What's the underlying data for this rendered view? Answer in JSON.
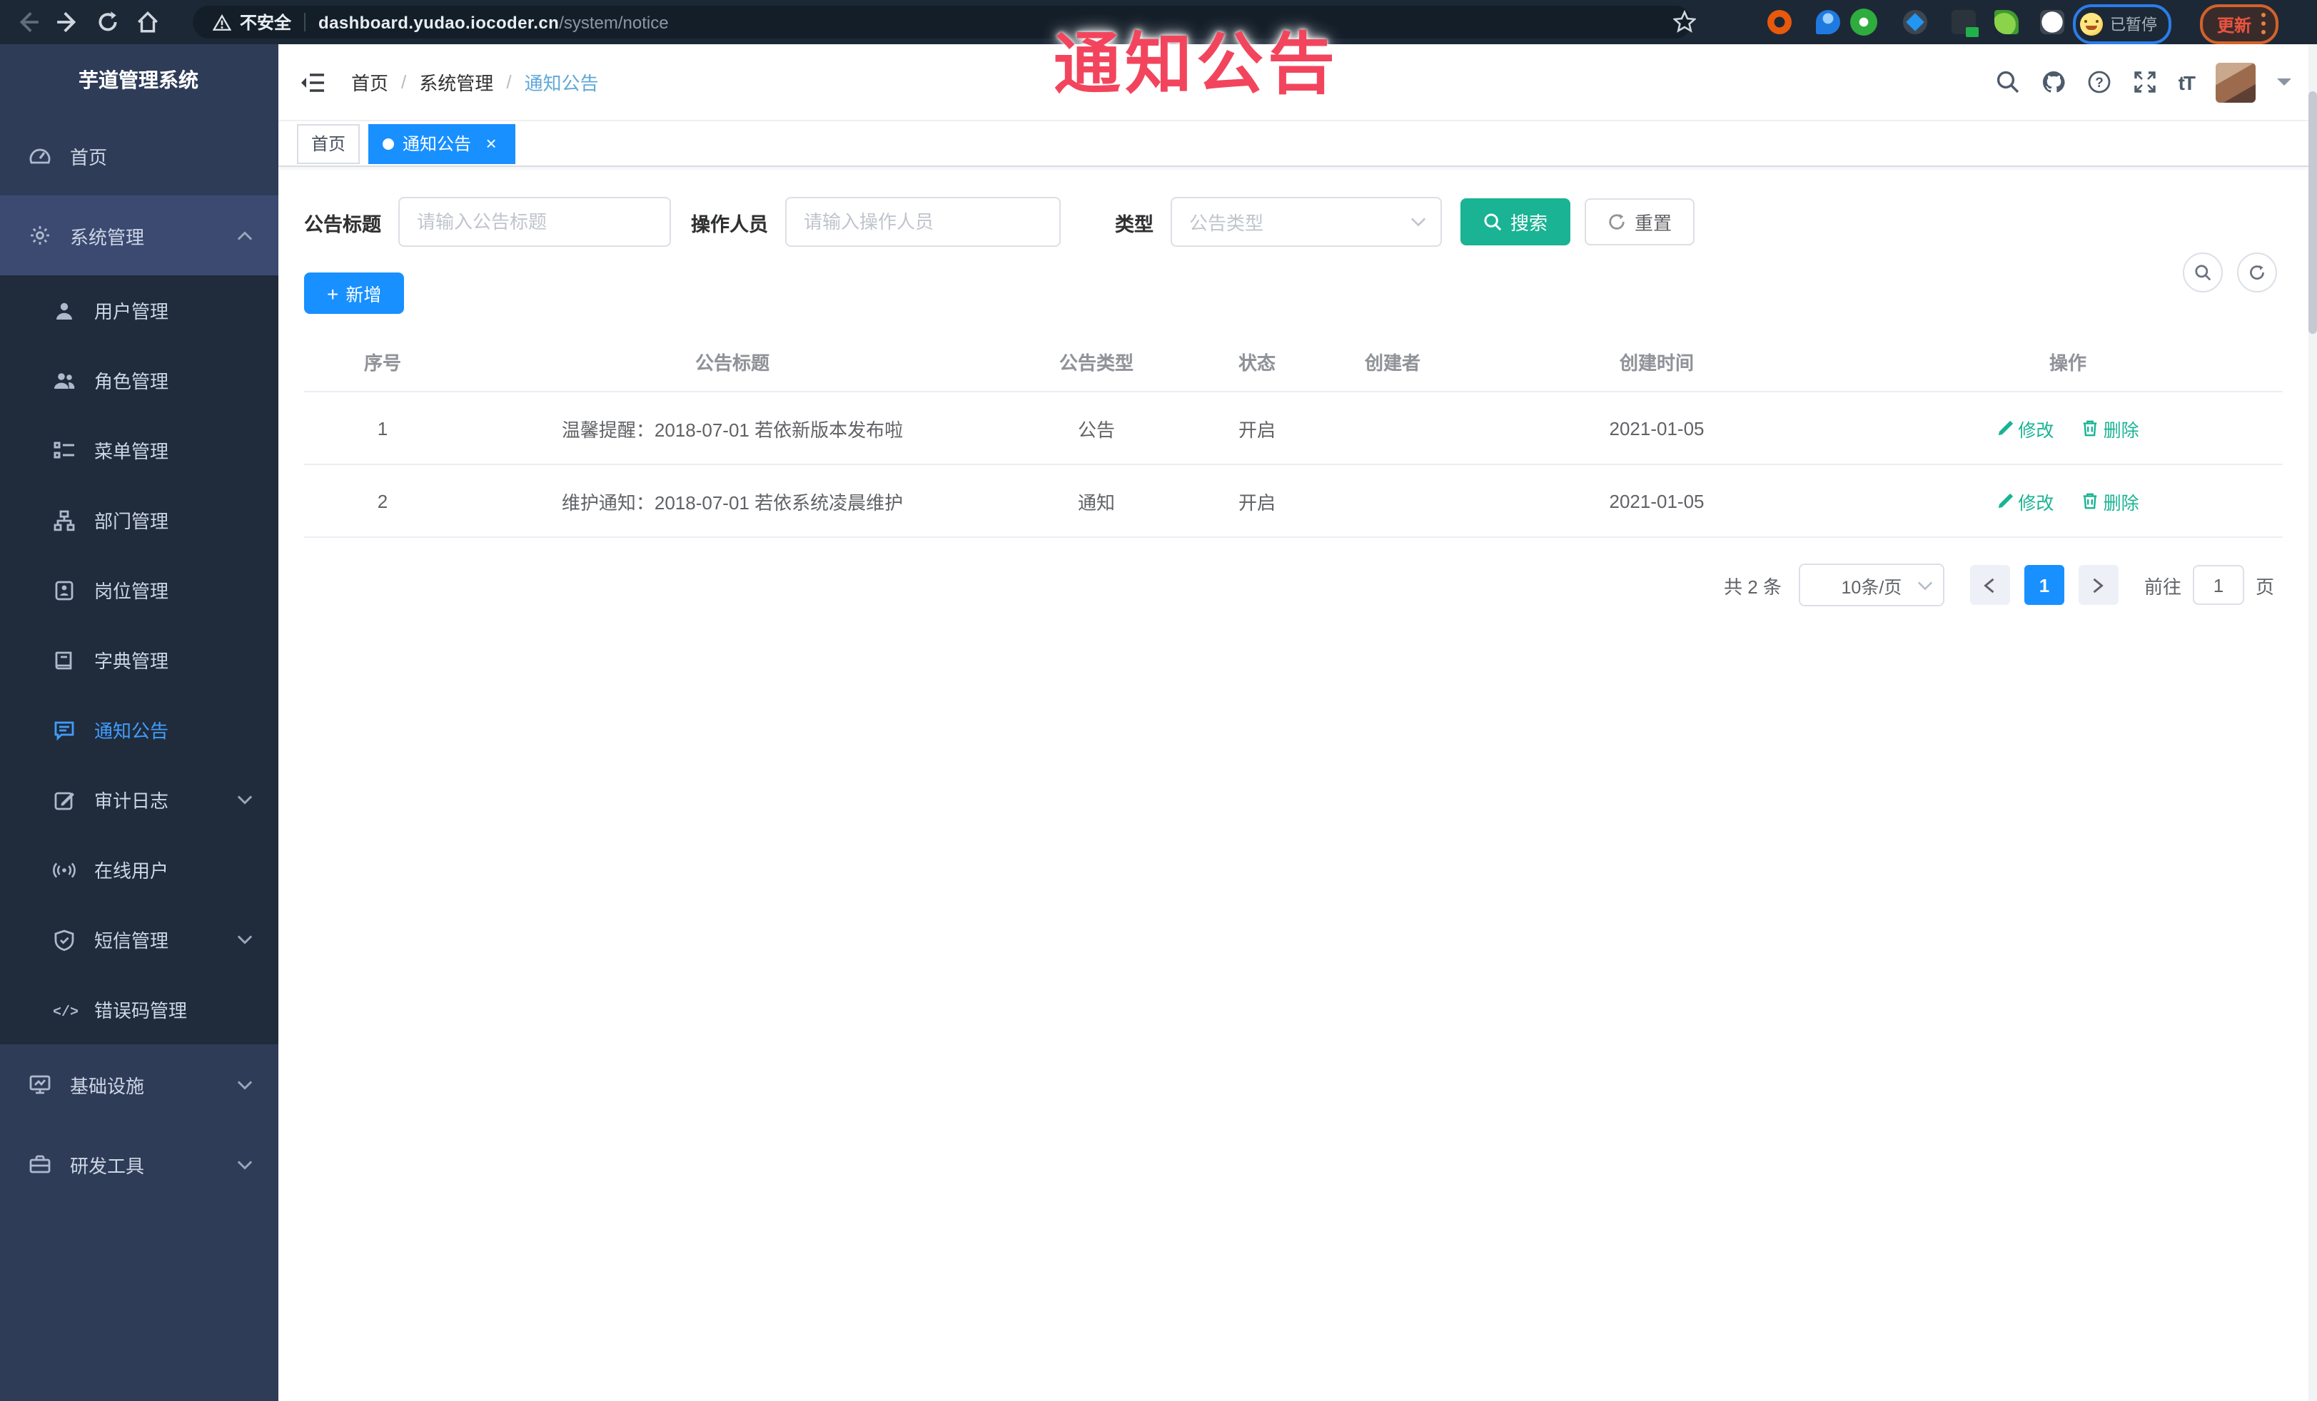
{
  "browser": {
    "security_warning": "不安全",
    "url_host": "dashboard.yudao.iocoder.cn",
    "url_path": "/system/notice",
    "paused_badge": "已暂停",
    "update_button": "更新"
  },
  "annotation": {
    "text": "通知公告"
  },
  "icons": {
    "close": "×",
    "plus": "+",
    "help_glyph": "?",
    "font_size_text": "tT",
    "error_code_text": "</>"
  },
  "sidebar": {
    "logo_title": "芋道管理系统",
    "items": [
      {
        "label": "首页",
        "icon": "dashboard-icon"
      },
      {
        "label": "系统管理",
        "icon": "gear-icon",
        "expanded": true
      },
      {
        "label": "用户管理",
        "icon": "user-icon"
      },
      {
        "label": "角色管理",
        "icon": "users-icon"
      },
      {
        "label": "菜单管理",
        "icon": "menu-list-icon"
      },
      {
        "label": "部门管理",
        "icon": "org-tree-icon"
      },
      {
        "label": "岗位管理",
        "icon": "badge-icon"
      },
      {
        "label": "字典管理",
        "icon": "dictionary-icon"
      },
      {
        "label": "通知公告",
        "icon": "announcement-icon",
        "active": true
      },
      {
        "label": "审计日志",
        "icon": "log-icon",
        "collapsible": true
      },
      {
        "label": "在线用户",
        "icon": "online-user-icon"
      },
      {
        "label": "短信管理",
        "icon": "sms-icon",
        "collapsible": true
      },
      {
        "label": "错误码管理",
        "icon": "error-code-icon"
      },
      {
        "label": "基础设施",
        "icon": "infrastructure-icon",
        "collapsible": true
      },
      {
        "label": "研发工具",
        "icon": "devtools-icon",
        "collapsible": true
      }
    ]
  },
  "header": {
    "breadcrumb": [
      "首页",
      "系统管理",
      "通知公告"
    ],
    "separator": "/"
  },
  "tabs": [
    {
      "label": "首页",
      "active": false
    },
    {
      "label": "通知公告",
      "active": true
    }
  ],
  "filters": {
    "title_label": "公告标题",
    "title_placeholder": "请输入公告标题",
    "operator_label": "操作人员",
    "operator_placeholder": "请输入操作人员",
    "type_label": "类型",
    "type_placeholder": "公告类型",
    "search_label": "搜索",
    "reset_label": "重置"
  },
  "toolbar": {
    "add_label": "新增"
  },
  "table": {
    "columns": [
      "序号",
      "公告标题",
      "公告类型",
      "状态",
      "创建者",
      "创建时间",
      "操作"
    ],
    "rows": [
      {
        "no": "1",
        "title": "温馨提醒：2018-07-01 若依新版本发布啦",
        "type": "公告",
        "status": "开启",
        "creator": "",
        "created": "2021-01-05"
      },
      {
        "no": "2",
        "title": "维护通知：2018-07-01 若依系统凌晨维护",
        "type": "通知",
        "status": "开启",
        "creator": "",
        "created": "2021-01-05"
      }
    ],
    "edit_label": "修改",
    "delete_label": "删除"
  },
  "pagination": {
    "total_text": "共 2 条",
    "page_size": "10条/页",
    "current_page": "1",
    "goto_label": "前往",
    "goto_value": "1",
    "page_unit": "页"
  },
  "colors": {
    "primary_blue": "#1890ff",
    "theme_teal": "#1ab394",
    "active_menu_blue": "#409eff",
    "annotation_red": "#f2455d",
    "topbar_bg": "#1d2836",
    "sidebar_bg": "#2e3c58",
    "submenu_bg": "#202b3b"
  }
}
